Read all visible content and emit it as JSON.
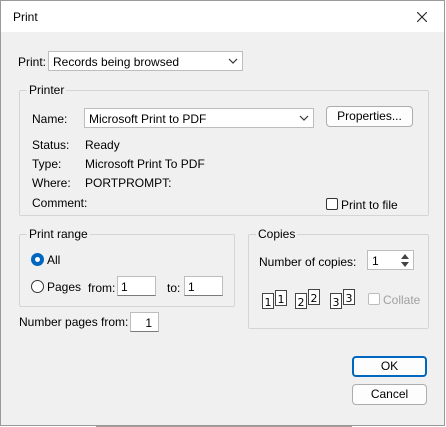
{
  "window": {
    "title": "Print"
  },
  "print_select": {
    "label": "Print:",
    "value": "Records being browsed"
  },
  "printer": {
    "group_title": "Printer",
    "name_label": "Name:",
    "name_value": "Microsoft Print to PDF",
    "properties_label": "Properties...",
    "status_label": "Status:",
    "status_value": "Ready",
    "type_label": "Type:",
    "type_value": "Microsoft Print To PDF",
    "where_label": "Where:",
    "where_value": "PORTPROMPT:",
    "comment_label": "Comment:",
    "print_to_file_label": "Print to file"
  },
  "print_range": {
    "group_title": "Print range",
    "all_label": "All",
    "pages_label": "Pages",
    "from_label": "from:",
    "from_value": "1",
    "to_label": "to:",
    "to_value": "1"
  },
  "copies": {
    "group_title": "Copies",
    "number_label": "Number of copies:",
    "number_value": "1",
    "collate_label": "Collate",
    "collate_pages": [
      "1",
      "1",
      "2",
      "2",
      "3",
      "3"
    ]
  },
  "number_pages_from": {
    "label": "Number pages from:",
    "value": "1"
  },
  "buttons": {
    "ok": "OK",
    "cancel": "Cancel"
  }
}
